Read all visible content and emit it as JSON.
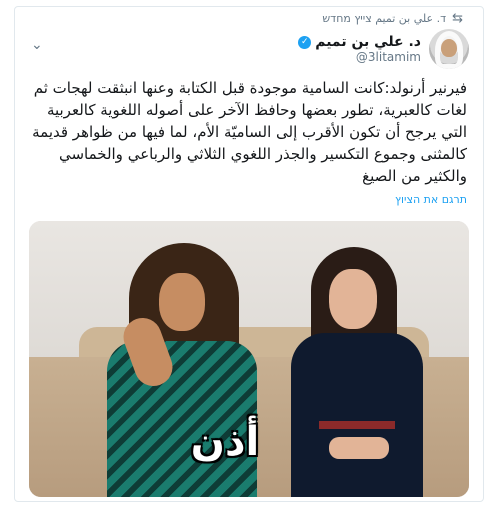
{
  "header": {
    "retweet_text": "ד. علي بن تميم צייץ מחדש",
    "display_name": "د. علي بن تميم",
    "handle": "@3litamim"
  },
  "tweet": {
    "text": "فيرنير أرنولد:كانت السامية موجودة قبل الكتابة وعنها انبثقت لهجات ثم لغات كالعبرية، تطور بعضها وحافظ الآخر على أصوله اللغوية كالعربية التي يرجح أن تكون الأقرب إلى الساميّة الأم، لما فيها من ظواهر قديمة كالمثنى وجموع التكسير والجذر اللغوي الثلاثي والرباعي والخماسي والكثير من الصيغ",
    "translate_label": "תרגם את הציוץ"
  },
  "media": {
    "overlay_word": "أذن"
  },
  "icons": {
    "retweet": "retweet-icon",
    "verified": "verified-badge-icon",
    "chevron": "chevron-down-icon"
  },
  "colors": {
    "accent": "#1da1f2",
    "muted": "#657786",
    "text": "#14171a"
  }
}
